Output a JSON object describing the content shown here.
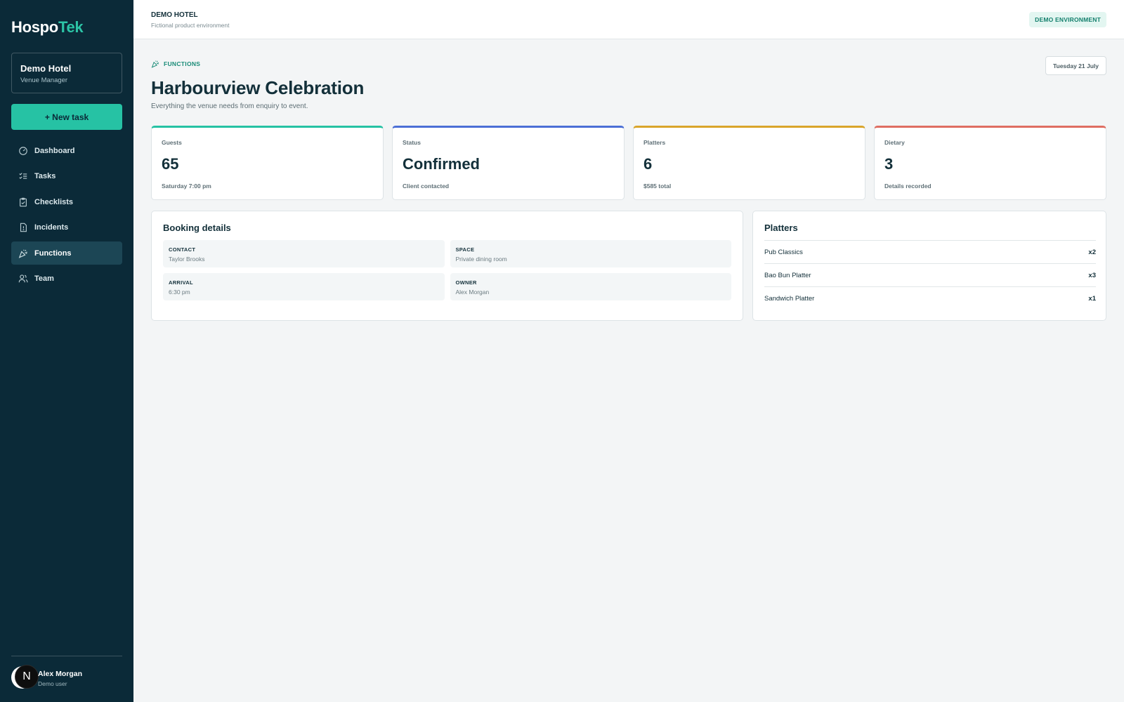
{
  "brand": {
    "name_part1": "Hospo",
    "name_part2": "Tek",
    "accent_color": "#26c2a4"
  },
  "venue": {
    "name": "Demo Hotel",
    "role": "Venue Manager"
  },
  "actions": {
    "new_task": "+ New task"
  },
  "nav": [
    {
      "label": "Dashboard",
      "icon": "gauge-icon",
      "active": false
    },
    {
      "label": "Tasks",
      "icon": "checklist-icon",
      "active": false
    },
    {
      "label": "Checklists",
      "icon": "clipboard-check-icon",
      "active": false
    },
    {
      "label": "Incidents",
      "icon": "file-alert-icon",
      "active": false
    },
    {
      "label": "Functions",
      "icon": "party-popper-icon",
      "active": true
    },
    {
      "label": "Team",
      "icon": "users-icon",
      "active": false
    }
  ],
  "user": {
    "initial": "N",
    "name": "Alex Morgan",
    "subtitle": "Demo user"
  },
  "header": {
    "title": "DEMO HOTEL",
    "subtitle": "Fictional product environment",
    "env_badge": "DEMO ENVIRONMENT"
  },
  "page": {
    "section": "FUNCTIONS",
    "date": "Tuesday 21 July",
    "title": "Harbourview Celebration",
    "subtitle": "Everything the venue needs from enquiry to event."
  },
  "stats": [
    {
      "label": "Guests",
      "value": "65",
      "note": "Saturday 7:00 pm",
      "color": "#26c2a4"
    },
    {
      "label": "Status",
      "value": "Confirmed",
      "note": "Client contacted",
      "color": "#4b6fd6"
    },
    {
      "label": "Platters",
      "value": "6",
      "note": "$585 total",
      "color": "#d9a52b"
    },
    {
      "label": "Dietary",
      "value": "3",
      "note": "Details recorded",
      "color": "#df6e62"
    }
  ],
  "booking": {
    "title": "Booking details",
    "details": [
      {
        "key": "CONTACT",
        "value": "Taylor Brooks"
      },
      {
        "key": "SPACE",
        "value": "Private dining room"
      },
      {
        "key": "ARRIVAL",
        "value": "6:30 pm"
      },
      {
        "key": "OWNER",
        "value": "Alex Morgan"
      }
    ]
  },
  "platters": {
    "title": "Platters",
    "items": [
      {
        "name": "Pub Classics",
        "qty": "x2"
      },
      {
        "name": "Bao Bun Platter",
        "qty": "x3"
      },
      {
        "name": "Sandwich Platter",
        "qty": "x1"
      }
    ]
  }
}
